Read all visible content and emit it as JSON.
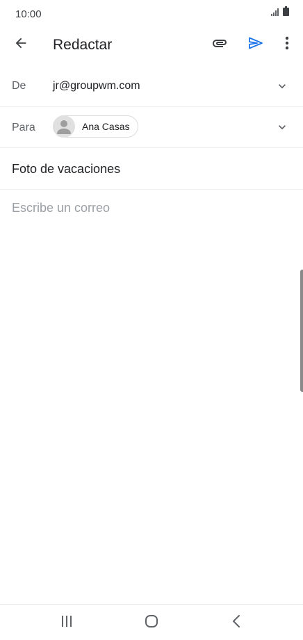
{
  "status_bar": {
    "time": "10:00"
  },
  "app_bar": {
    "title": "Redactar",
    "back_icon": "arrow-back-icon",
    "attach_icon": "paperclip-icon",
    "send_icon": "send-icon",
    "more_icon": "more-vert-icon"
  },
  "compose": {
    "from_label": "De",
    "from_value": "jr@groupwm.com",
    "to_label": "Para",
    "to_chip_name": "Ana Casas",
    "subject": "Foto de vacaciones",
    "body_placeholder": "Escribe un correo"
  },
  "colors": {
    "accent": "#1a73e8",
    "text_primary": "#202124",
    "text_secondary": "#5f6368",
    "placeholder": "#9aa0a6"
  }
}
